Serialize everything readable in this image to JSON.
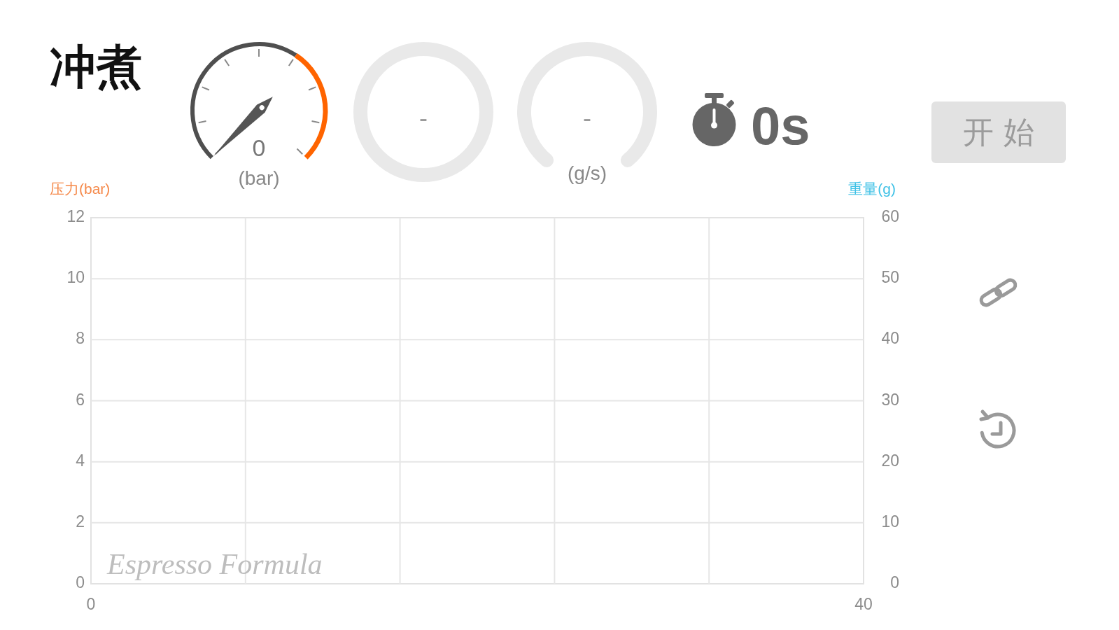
{
  "title": "冲煮",
  "gauges": [
    {
      "kind": "dial",
      "value": "0",
      "unit": "(bar)"
    },
    {
      "kind": "ring",
      "value": "-"
    },
    {
      "kind": "arc",
      "value": "-",
      "unit": "(g/s)"
    }
  ],
  "timer": {
    "value": "0s"
  },
  "start_button": {
    "label": "开 始",
    "disabled": true
  },
  "chart": {
    "chart_data": {
      "type": "line",
      "ylabel": "压力(bar)",
      "y2label": "重量(g)",
      "xlim": [
        0,
        40
      ],
      "ylim": [
        0,
        12
      ],
      "y2lim": [
        0,
        60
      ],
      "xticks": [
        0,
        40
      ],
      "yticks": [
        0,
        2,
        4,
        6,
        8,
        10,
        12
      ],
      "y2ticks": [
        0,
        10,
        20,
        30,
        40,
        50,
        60
      ],
      "grid": true,
      "annotations": [
        "Espresso Formula"
      ]
    }
  }
}
